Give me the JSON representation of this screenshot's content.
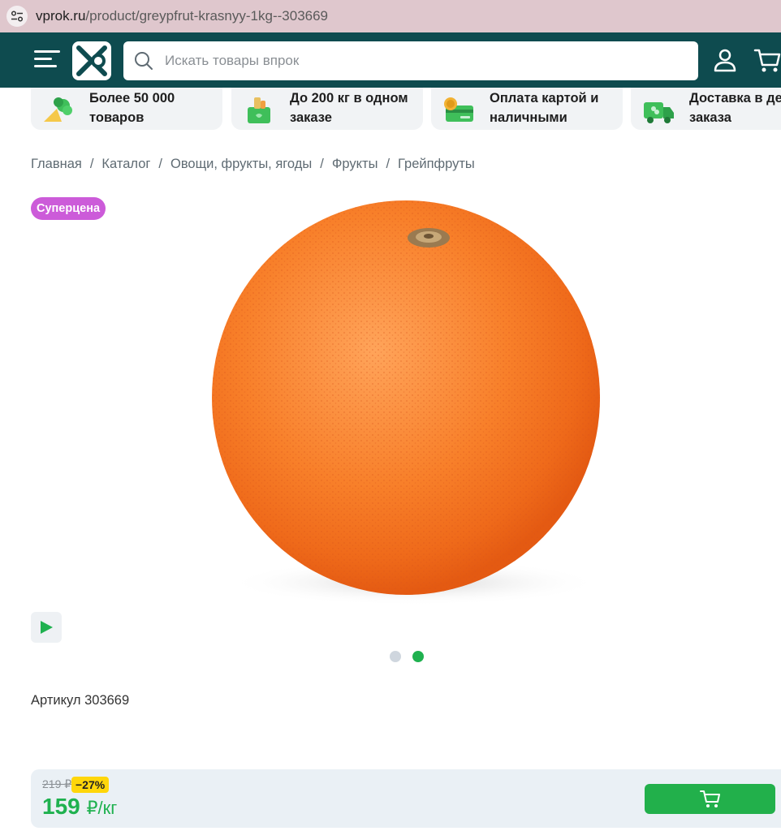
{
  "browser": {
    "url_domain": "vprok.ru",
    "url_path": "/product/greypfrut-krasnyy-1kg--303669"
  },
  "header": {
    "search_placeholder": "Искать товары впрок",
    "bg_color": "#0e4b4f"
  },
  "features": [
    {
      "line1": "Более 50 000",
      "line2": "товаров",
      "icon": "vegetables-icon"
    },
    {
      "line1": "До 200 кг в одном",
      "line2": "заказе",
      "icon": "grocery-bag-icon"
    },
    {
      "line1": "Оплата картой и",
      "line2": "наличными",
      "icon": "card-coin-icon"
    },
    {
      "line1": "Доставка в де",
      "line2": "заказа",
      "icon": "delivery-truck-icon"
    }
  ],
  "breadcrumb": [
    "Главная",
    "Каталог",
    "Овощи, фрукты, ягоды",
    "Фрукты",
    "Грейпфруты"
  ],
  "product": {
    "badge": "Суперцена",
    "article": "Артикул 303669",
    "old_price": "219 ₽",
    "discount": "−27%",
    "price": "159",
    "price_unit": "₽/кг",
    "gallery_active_index": 1,
    "gallery_count": 2
  },
  "colors": {
    "accent_green": "#1fb14f",
    "badge_purple": "#cc5bd9",
    "discount_yellow": "#ffd60a"
  }
}
